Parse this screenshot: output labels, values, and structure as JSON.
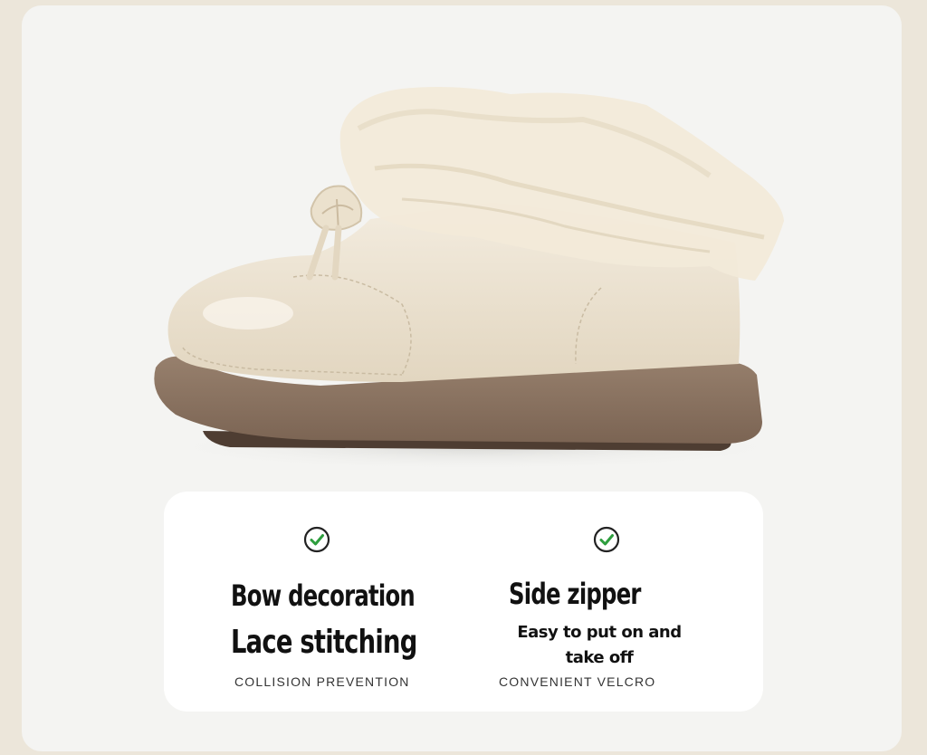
{
  "colors": {
    "page_background": "#ece6da",
    "card_background": "#f4f4f2",
    "panel_background": "#ffffff",
    "check_green": "#2e9e3e",
    "shoe_cream": "#ece2cf",
    "sole_brown": "#8a7260"
  },
  "features": {
    "left": {
      "icon": "check-circle-icon",
      "title_line1": "Bow decoration",
      "title_line2": "Lace stitching",
      "caption": "COLLISION PREVENTION"
    },
    "right": {
      "icon": "check-circle-icon",
      "title": "Side zipper",
      "subtitle": "Easy to put on and take off",
      "caption": "CONVENIENT VELCRO"
    }
  }
}
